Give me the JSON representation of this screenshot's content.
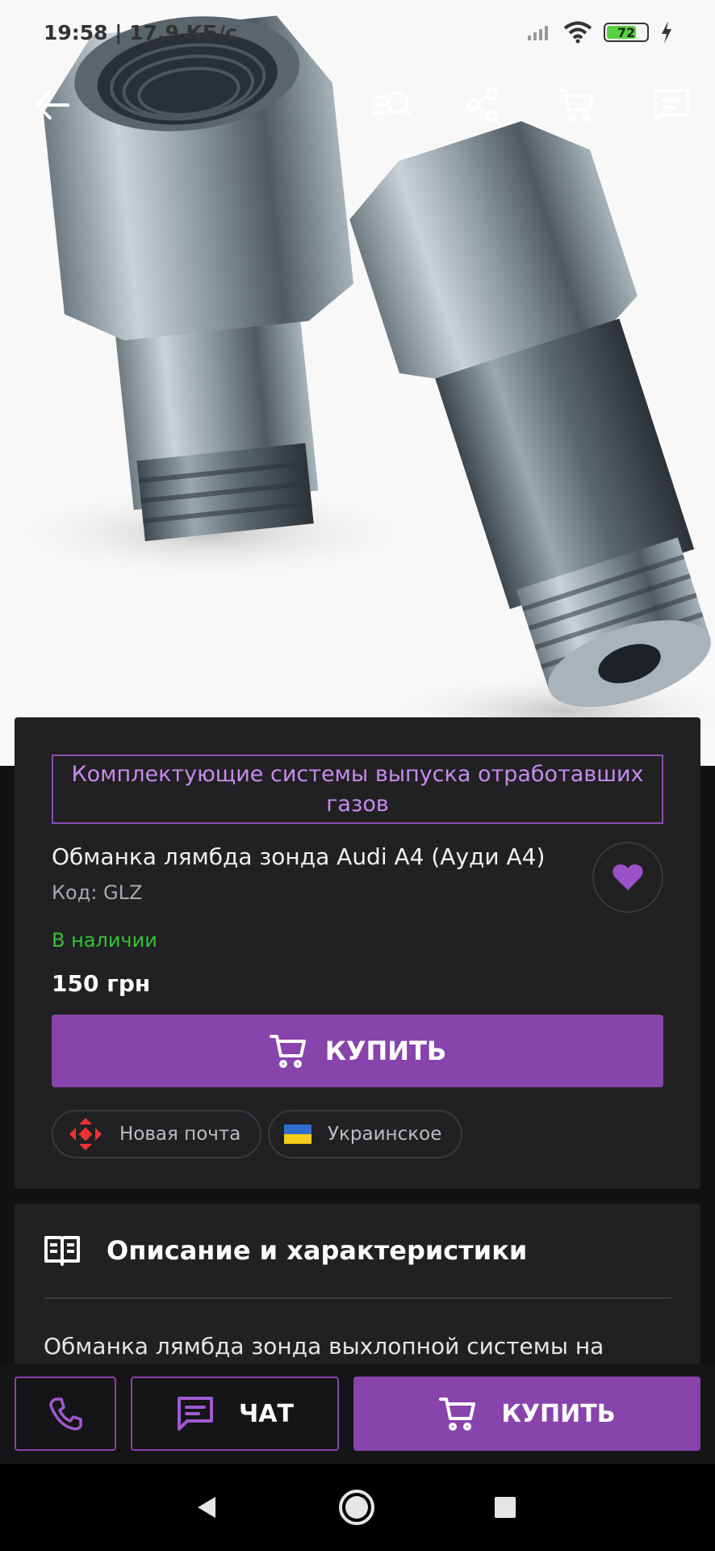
{
  "status_bar": {
    "time_speed": "19:58 | 17,9 КБ/с",
    "battery": "72"
  },
  "product": {
    "category": "Комплектующие системы выпуска отработавших газов",
    "title": "Обманка лямбда зонда Audi A4 (Ауди A4)",
    "code": "Код: GLZ",
    "availability": "В наличии",
    "price": "150 грн",
    "buy_label": "КУПИТЬ"
  },
  "chips": [
    {
      "label": "Новая почта",
      "icon": "nova-poshta-icon"
    },
    {
      "label": "Украинское",
      "icon": "ukraine-flag-icon"
    }
  ],
  "description": {
    "heading": "Описание и характеристики",
    "text": "Обманка лямбда зонда выхлопной системы на"
  },
  "bottom_bar": {
    "chat_label": "ЧАТ",
    "buy_label": "КУПИТЬ"
  },
  "colors": {
    "accent": "#8843ac",
    "accent_text": "#c58cec",
    "in_stock": "#37c234",
    "card_bg": "#212023"
  }
}
